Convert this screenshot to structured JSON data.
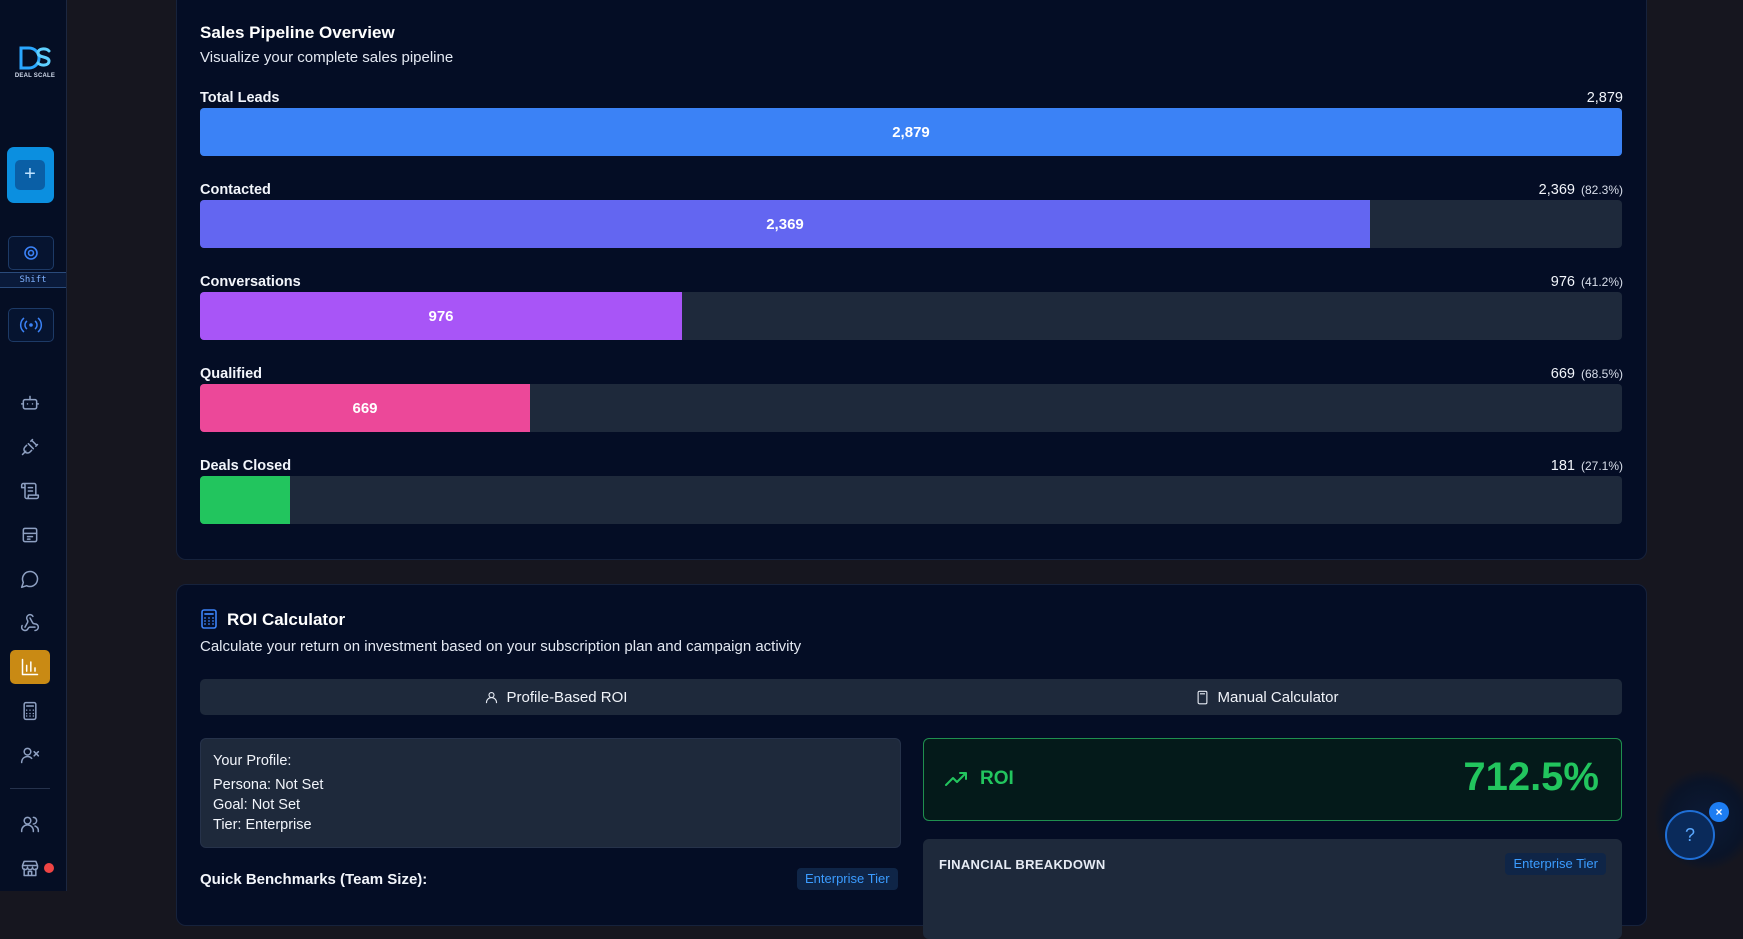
{
  "sidebar": {
    "logo_text": "DEAL SCALE",
    "shift_label": "Shift",
    "colors": {
      "accent": "#0b8fe0",
      "active": "#c98a14"
    },
    "icons": [
      "robot-icon",
      "plug-icon",
      "scroll-icon",
      "calendar-icon",
      "chat-icon",
      "webhook-icon",
      "bar-chart-icon",
      "calculator-icon",
      "user-x-icon",
      "users-icon",
      "store-icon"
    ],
    "active_item": "bar-chart-icon"
  },
  "pipeline": {
    "title": "Sales Pipeline Overview",
    "subtitle": "Visualize your complete sales pipeline",
    "stages": [
      {
        "label": "Total Leads",
        "value": "2,879",
        "pct": "",
        "fill_fraction": 1.0,
        "bar_text": "2,879",
        "color": "#3b82f6"
      },
      {
        "label": "Contacted",
        "value": "2,369",
        "pct": "(82.3%)",
        "fill_fraction": 0.823,
        "bar_text": "2,369",
        "color": "#6366f1"
      },
      {
        "label": "Conversations",
        "value": "976",
        "pct": "(41.2%)",
        "fill_fraction": 0.339,
        "bar_text": "976",
        "color": "#a855f7"
      },
      {
        "label": "Qualified",
        "value": "669",
        "pct": "(68.5%)",
        "fill_fraction": 0.232,
        "bar_text": "669",
        "color": "#ec4899"
      },
      {
        "label": "Deals Closed",
        "value": "181",
        "pct": "(27.1%)",
        "fill_fraction": 0.063,
        "bar_text": "",
        "color": "#22c55e"
      }
    ]
  },
  "roi": {
    "title": "ROI Calculator",
    "subtitle": "Calculate your return on investment based on your subscription plan and campaign activity",
    "tabs": {
      "profile": "Profile-Based ROI",
      "manual": "Manual Calculator"
    },
    "profile": {
      "heading": "Your Profile:",
      "persona_label": "Persona:",
      "persona_value": "Not Set",
      "goal_label": "Goal:",
      "goal_value": "Not Set",
      "tier_label": "Tier:",
      "tier_value": "Enterprise"
    },
    "benchmarks_title": "Quick Benchmarks (Team Size):",
    "tier_badge": "Enterprise Tier",
    "roi_label": "ROI",
    "roi_value": "712.5%",
    "financial_title": "FINANCIAL BREAKDOWN",
    "financial_badge": "Enterprise Tier"
  },
  "help": {
    "button_label": "?",
    "close_label": "×"
  }
}
